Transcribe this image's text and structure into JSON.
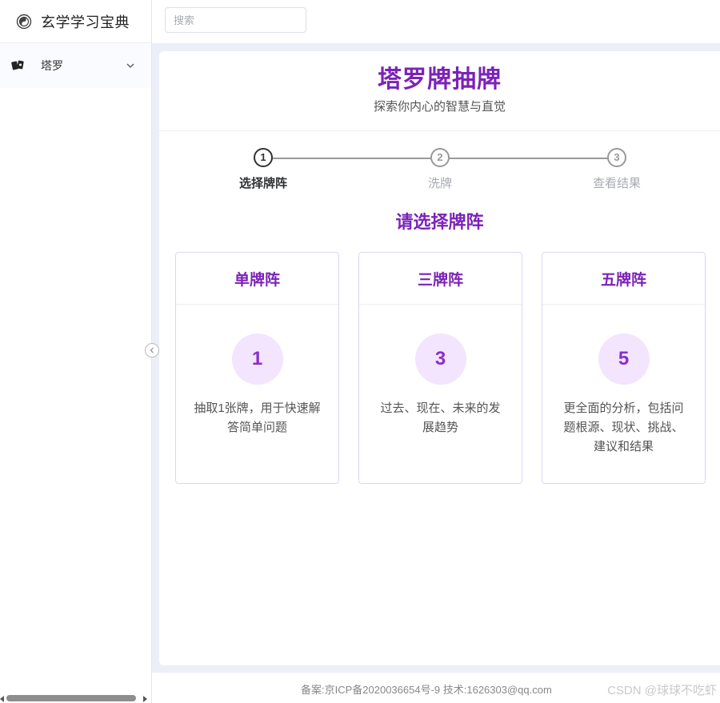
{
  "app": {
    "title": "玄学学习宝典"
  },
  "sidebar": {
    "items": [
      {
        "label": "塔罗",
        "icon": "tarot-cards-icon",
        "expanded": false
      }
    ]
  },
  "search": {
    "placeholder": "搜索"
  },
  "page": {
    "title": "塔罗牌抽牌",
    "subtitle": "探索你内心的智慧与直觉"
  },
  "steps": [
    {
      "number": "1",
      "label": "选择牌阵",
      "active": true
    },
    {
      "number": "2",
      "label": "洗牌",
      "active": false
    },
    {
      "number": "3",
      "label": "查看结果",
      "active": false
    }
  ],
  "section": {
    "title": "请选择牌阵"
  },
  "spreads": [
    {
      "title": "单牌阵",
      "count": "1",
      "desc": "抽取1张牌，用于快速解答简单问题"
    },
    {
      "title": "三牌阵",
      "count": "3",
      "desc": "过去、现在、未来的发展趋势"
    },
    {
      "title": "五牌阵",
      "count": "5",
      "desc": "更全面的分析，包括问题根源、现状、挑战、建议和结果"
    }
  ],
  "footer": {
    "text": "备案:京ICP备2020036654号-9 技术:1626303@qq.com"
  },
  "watermark": "CSDN @球球不吃虾",
  "colors": {
    "accent": "#7b22b8",
    "accent_light": "#f3e5fd",
    "content_bg": "#eceef8"
  }
}
